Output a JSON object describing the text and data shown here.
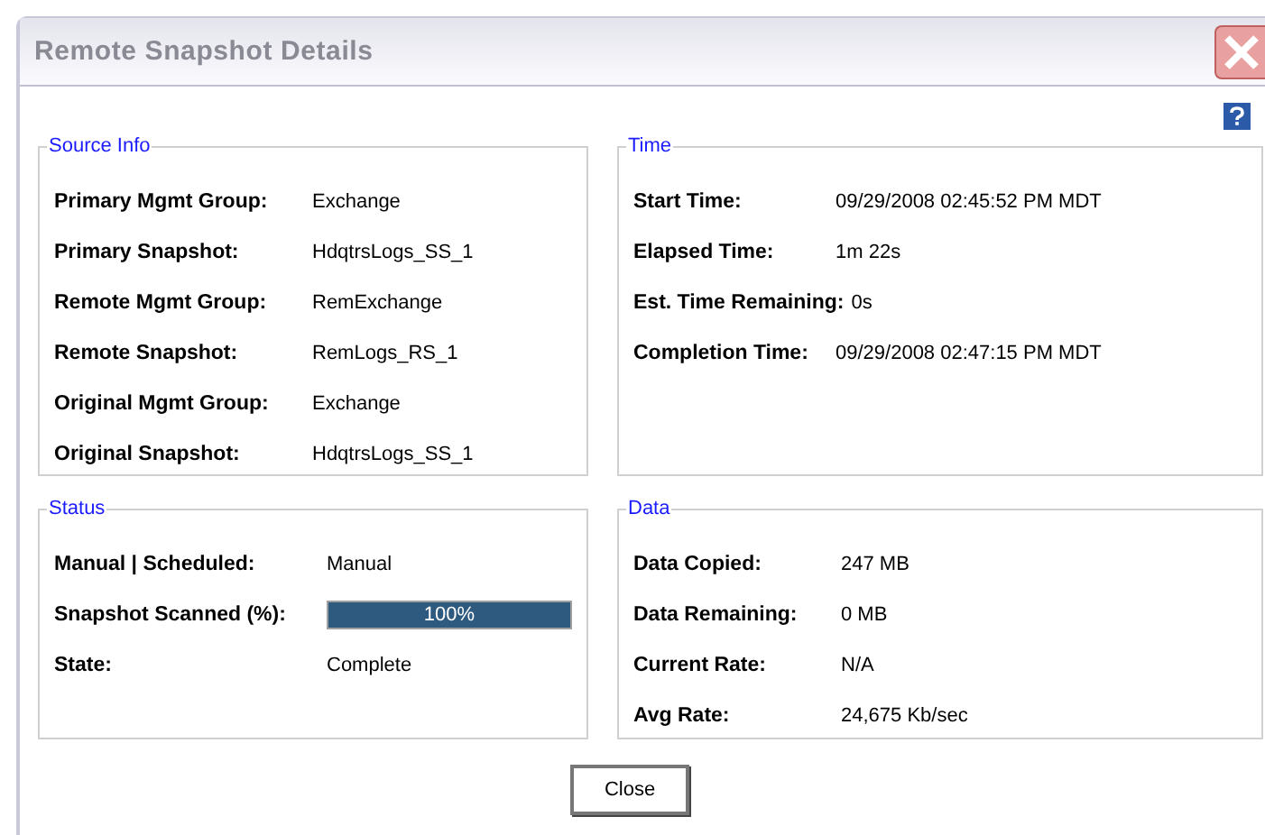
{
  "window": {
    "title": "Remote Snapshot Details"
  },
  "panels": [
    {
      "title": "Source Info",
      "rows": [
        {
          "label": "Primary Mgmt Group:",
          "value": "Exchange"
        },
        {
          "label": "Primary Snapshot:",
          "value": "HdqtrsLogs_SS_1"
        },
        {
          "label": "Remote Mgmt Group:",
          "value": "RemExchange"
        },
        {
          "label": "Remote Snapshot:",
          "value": "RemLogs_RS_1"
        },
        {
          "label": "Original Mgmt Group:",
          "value": "Exchange"
        },
        {
          "label": "Original Snapshot:",
          "value": "HdqtrsLogs_SS_1"
        }
      ]
    },
    {
      "title": "Time",
      "rows": [
        {
          "label": "Start Time:",
          "value": "09/29/2008 02:45:52 PM MDT"
        },
        {
          "label": "Elapsed Time:",
          "value": "1m 22s"
        },
        {
          "label": "Est. Time Remaining:",
          "value": "0s"
        },
        {
          "label": "Completion Time:",
          "value": "09/29/2008 02:47:15 PM MDT"
        }
      ]
    },
    {
      "title": "Status",
      "rows": [
        {
          "label": "Manual | Scheduled:",
          "kind": "text",
          "value": "Manual"
        },
        {
          "label": "Snapshot Scanned (%):",
          "kind": "progress",
          "value": "100%",
          "level": 1
        },
        {
          "label": "State:",
          "kind": "text",
          "value": "Complete"
        }
      ]
    },
    {
      "title": "Data",
      "rows": [
        {
          "label": "Data Copied:",
          "value": "247 MB"
        },
        {
          "label": "Data Remaining:",
          "value": "0 MB"
        },
        {
          "label": "Current Rate:",
          "value": "N/A"
        },
        {
          "label": "Avg Rate:",
          "value": "24,675 Kb/sec"
        }
      ]
    }
  ],
  "buttons": [
    "Close"
  ]
}
